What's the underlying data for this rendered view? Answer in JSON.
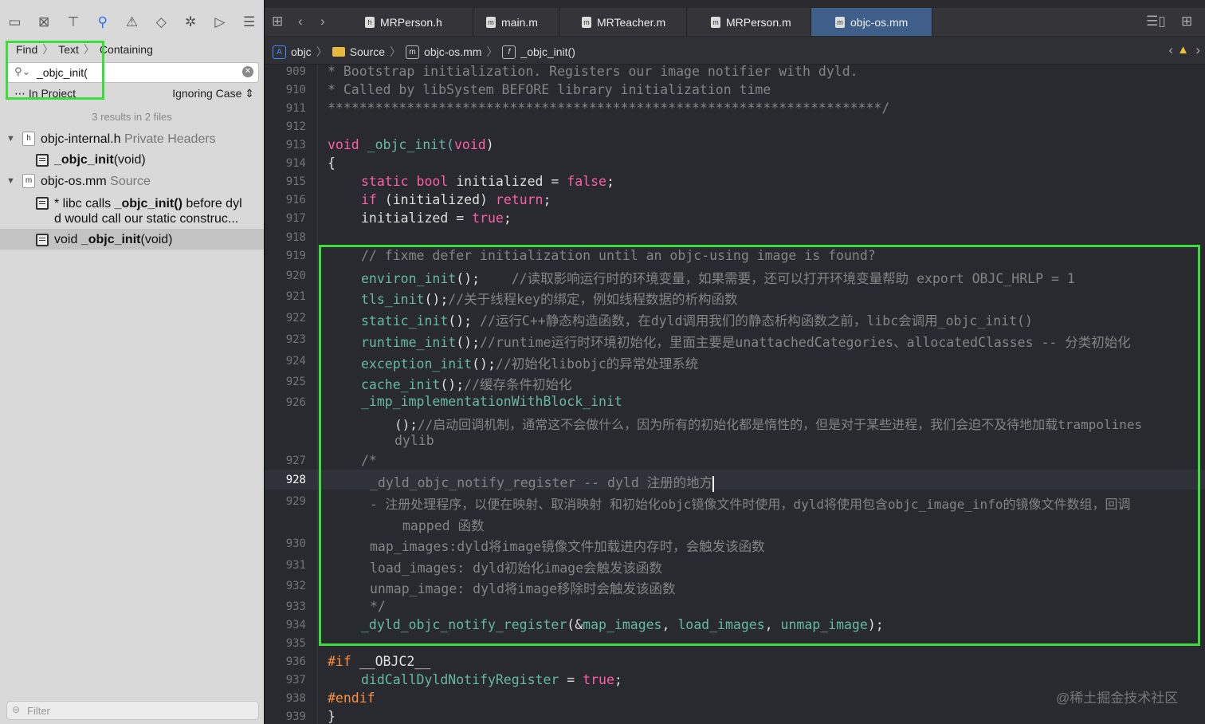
{
  "navigator": {
    "toolbar_icons": [
      "folder-icon",
      "source-control-icon",
      "hierarchy-icon",
      "search-icon",
      "warning-icon",
      "test-icon",
      "debug-icon",
      "breakpoint-icon",
      "report-icon"
    ],
    "find_path": [
      "Find",
      "Text",
      "Containing"
    ],
    "search_value": "_objc_init(",
    "scope": "In Project",
    "match_case": "Ignoring Case",
    "summary": "3 results in 2 files",
    "results": [
      {
        "file": "objc-internal.h",
        "group": "Private Headers",
        "matches": [
          {
            "pre": "",
            "hit": "_objc_init",
            "post": "(void)"
          }
        ]
      },
      {
        "file": "objc-os.mm",
        "group": "Source",
        "matches": [
          {
            "line1_pre": "* libc calls ",
            "hit": "_objc_init()",
            "line1_post": " before dyl",
            "line2": "d would call our static construc..."
          },
          {
            "pre": "void ",
            "hit": "_objc_init",
            "post": "(void)"
          }
        ]
      }
    ],
    "filter_placeholder": "Filter"
  },
  "tabs": [
    "MRPerson.h",
    "main.m",
    "MRTeacher.m",
    "MRPerson.m",
    "objc-os.mm"
  ],
  "active_tab": "objc-os.mm",
  "jumpbar": [
    "objc",
    "Source",
    "objc-os.mm",
    "_objc_init()"
  ],
  "lines": {
    "909": "909",
    "910": "910",
    "911": "911",
    "912": "912",
    "913": "913",
    "914": "914",
    "915": "915",
    "916": "916",
    "917": "917",
    "918": "918",
    "919": "919",
    "920": "920",
    "921": "921",
    "922": "922",
    "923": "923",
    "924": "924",
    "925": "925",
    "926": "926",
    "927": "927",
    "928": "928",
    "929": "929",
    "930": "930",
    "931": "931",
    "932": "932",
    "933": "933",
    "934": "934",
    "935": "935",
    "936": "936",
    "937": "937",
    "938": "938",
    "939": "939"
  },
  "code": {
    "l909": "* Bootstrap initialization. Registers our image notifier with dyld.",
    "l910": "* Called by libSystem BEFORE library initialization time",
    "l911": "**********************************************************************/",
    "l913_kw": "void",
    "l913_fn": " _objc_init(",
    "l913_kw2": "void",
    "l913_end": ")",
    "l914": "{",
    "l915_kw": "static bool",
    "l915_mid": " initialized = ",
    "l915_kw2": "false",
    "l915_end": ";",
    "l916_kw": "if",
    "l916_mid": " (initialized) ",
    "l916_kw2": "return",
    "l916_end": ";",
    "l917_mid": "initialized = ",
    "l917_kw": "true",
    "l917_end": ";",
    "l919": "// fixme defer initialization until an objc-using image is found?",
    "l920_fn": "environ_init",
    "l920_p": "();",
    "l920_cm": "//读取影响运行时的环境变量，如果需要，还可以打开环境变量帮助 export OBJC_HRLP = 1",
    "l921_fn": "tls_init",
    "l921_p": "();",
    "l921_cm": "//关于线程key的绑定，例如线程数据的析构函数",
    "l922_fn": "static_init",
    "l922_p": "();",
    "l922_cm": "//运行C++静态构造函数，在dyld调用我们的静态析构函数之前，libc会调用_objc_init()",
    "l923_fn": "runtime_init",
    "l923_p": "();",
    "l923_cm": "//runtime运行时环境初始化，里面主要是unattachedCategories、allocatedClasses -- 分类初始化",
    "l924_fn": "exception_init",
    "l924_p": "();",
    "l924_cm": "//初始化libobjc的异常处理系统",
    "l925_fn": "cache_init",
    "l925_p": "();",
    "l925_cm": "//缓存条件初始化",
    "l926_fn": "_imp_implementationWithBlock_init",
    "l926b_p": "();",
    "l926b_cm": "//启动回调机制，通常这不会做什么，因为所有的初始化都是惰性的，但是对于某些进程，我们会迫不及待地加载trampolines",
    "l926c_cm": "dylib",
    "l927": "/*",
    "l928": "_dyld_objc_notify_register -- dyld 注册的地方",
    "l929a": "- 注册处理程序，以便在映射、取消映射 和初始化objc镜像文件时使用，dyld将使用包含objc_image_info的镜像文件数组，回调",
    "l929b": "mapped 函数",
    "l930": "map_images:dyld将image镜像文件加载进内存时，会触发该函数",
    "l931": "load_images: dyld初始化image会触发该函数",
    "l932": "unmap_image: dyld将image移除时会触发该函数",
    "l933": "*/",
    "l934_fn": "_dyld_objc_notify_register",
    "l934_a": "(&",
    "l934_b": "map_images",
    "l934_c": ", ",
    "l934_d": "load_images",
    "l934_e": ", ",
    "l934_f": "unmap_image",
    "l934_g": ");",
    "l936_pp": "#if",
    "l936_rest": " __OBJC2__",
    "l937_fn": "didCallDyldNotifyRegister",
    "l937_mid": " = ",
    "l937_kw": "true",
    "l937_end": ";",
    "l938_pp": "#endif",
    "l939": "}"
  },
  "watermark": "@稀土掘金技术社区",
  "colors": {
    "highlight_box": "#3cdc3c",
    "keyword": "#fc5fa3",
    "comment": "#848484",
    "function": "#67b7a4",
    "preprocessor": "#fd8f3f",
    "active_tab": "#3e5f8a"
  }
}
